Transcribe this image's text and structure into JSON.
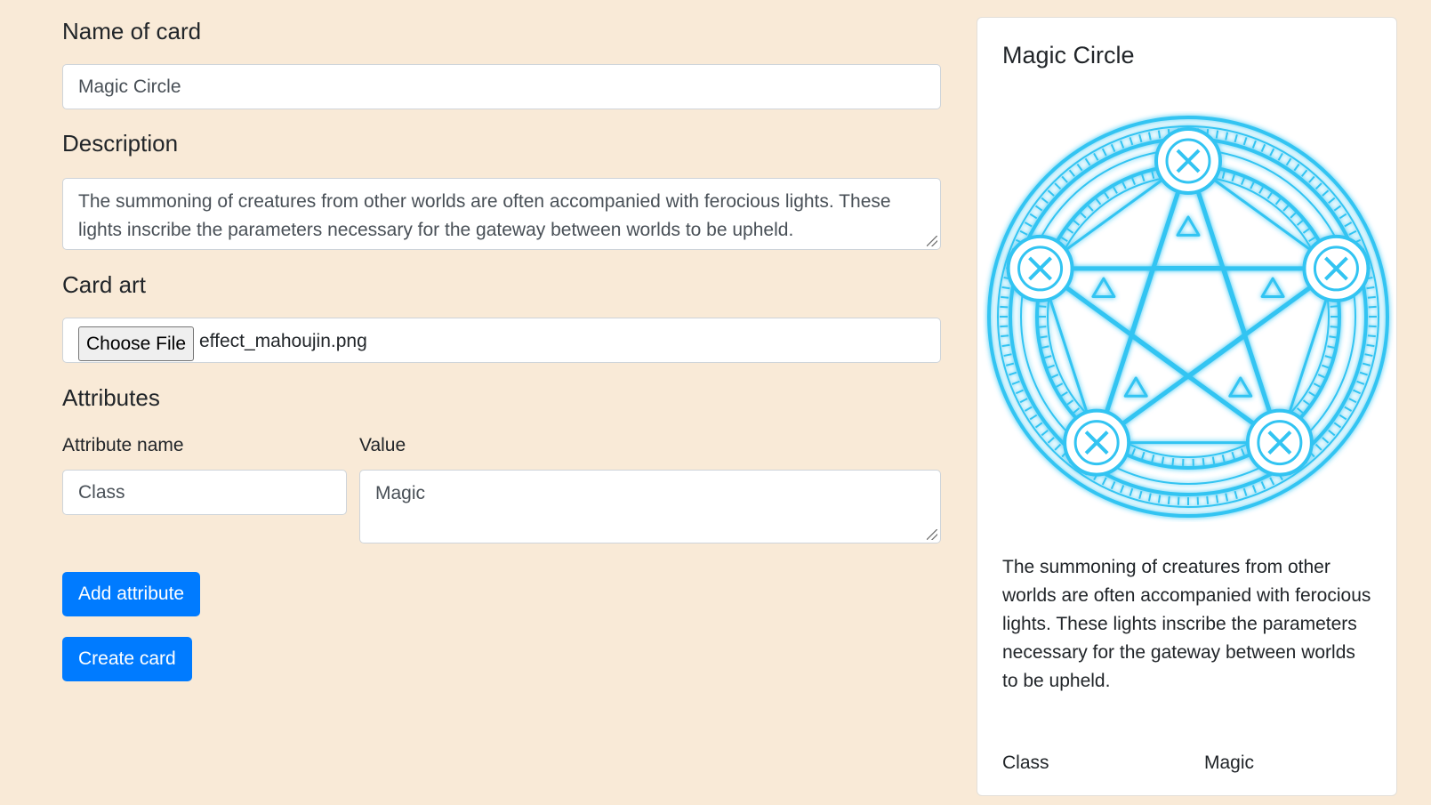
{
  "form": {
    "name_label": "Name of card",
    "name_value": "Magic Circle",
    "description_label": "Description",
    "description_value": "The summoning of creatures from other worlds are often accompanied with ferocious lights. These lights inscribe the parameters necessary for the gateway between worlds to be upheld.",
    "card_art_label": "Card art",
    "file_button_label": "Choose File",
    "file_name": "effect_mahoujin.png",
    "attributes_label": "Attributes",
    "attribute_name_label": "Attribute name",
    "attribute_value_label": "Value",
    "attributes": [
      {
        "name": "Class",
        "value": "Magic"
      }
    ],
    "add_attribute_label": "Add attribute",
    "create_card_label": "Create card"
  },
  "preview": {
    "title": "Magic Circle",
    "art_icon": "magic-circle",
    "accent_color": "#33c4f2",
    "description": "The summoning of creatures from other worlds are often accompanied with ferocious lights. These lights inscribe the parameters necessary for the gateway between worlds to be upheld.",
    "attributes": [
      {
        "name": "Class",
        "value": "Magic"
      }
    ]
  }
}
